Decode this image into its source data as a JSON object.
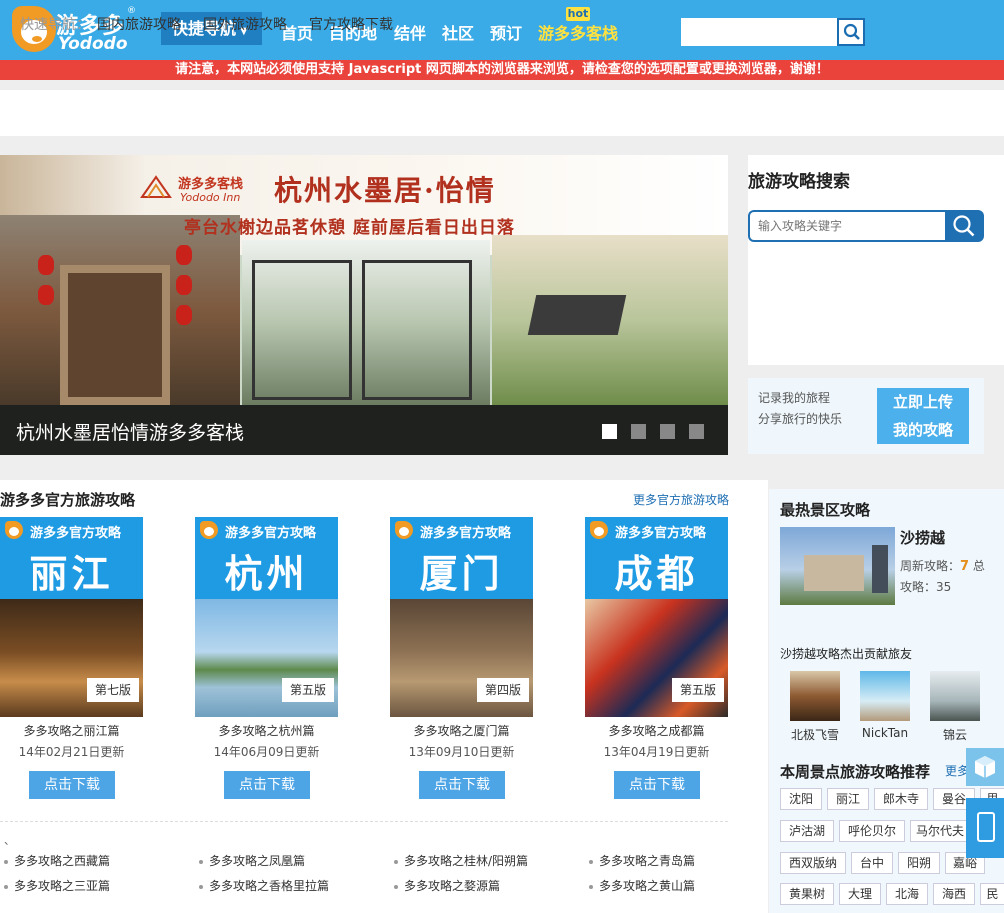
{
  "header": {
    "logo_cn": "游多多",
    "logo_en": "Yododo",
    "logo_reg": "®",
    "quicknav_label": "快捷导航",
    "nav": [
      "首页",
      "目的地",
      "结伴",
      "社区",
      "预订",
      "游多多客栈"
    ],
    "hot_tag": "hot",
    "search_value": ""
  },
  "warning": "请注意，本网站必须使用支持 Javascript 网页脚本的浏览器来浏览，请检查您的选项配置或更换浏览器，谢谢！",
  "quickbar": {
    "label": "快速导航：",
    "links": [
      "国内旅游攻略",
      "国外旅游攻略",
      "官方攻略下载"
    ]
  },
  "banner": {
    "brand_cn": "游多多客栈",
    "brand_en": "Yododo Inn",
    "title": "杭州水墨居·怡情",
    "subtitle": "亭台水榭边品茗休憩 庭前屋后看日出日落",
    "caption": "杭州水墨居怡情游多多客栈",
    "slides": 4,
    "active_slide": 1
  },
  "guide_search": {
    "title": "旅游攻略搜索",
    "placeholder": "输入攻略关键字"
  },
  "upload": {
    "line1": "记录我的旅程",
    "line2": "分享旅行的快乐",
    "button_line1": "立即上传",
    "button_line2": "我的攻略"
  },
  "official": {
    "title": "游多多官方旅游攻略",
    "more": "更多官方旅游攻略",
    "card_header": "游多多官方攻略",
    "download_label": "点击下载",
    "cards": [
      {
        "city": "丽江",
        "edition": "第七版",
        "label": "多多攻略之丽江篇",
        "date": "14年02月21日更新"
      },
      {
        "city": "杭州",
        "edition": "第五版",
        "label": "多多攻略之杭州篇",
        "date": "14年06月09日更新"
      },
      {
        "city": "厦门",
        "edition": "第四版",
        "label": "多多攻略之厦门篇",
        "date": "13年09月10日更新"
      },
      {
        "city": "成都",
        "edition": "第五版",
        "label": "多多攻略之成都篇",
        "date": "13年04月19日更新"
      }
    ],
    "tick": "、",
    "list": [
      [
        "多多攻略之西藏篇",
        "多多攻略之凤凰篇",
        "多多攻略之桂林/阳朔篇",
        "多多攻略之青岛篇"
      ],
      [
        "多多攻略之三亚篇",
        "多多攻略之香格里拉篇",
        "多多攻略之婺源篇",
        "多多攻略之黄山篇"
      ]
    ]
  },
  "hot": {
    "title": "最热景区攻略",
    "name": "沙捞越",
    "weekly_label": "周新攻略：",
    "weekly_value": "7",
    "total_suffix": "总",
    "total_label": "攻略：",
    "total_value": "35",
    "contrib_title": "沙捞越攻略杰出贡献旅友",
    "contributors": [
      "北极飞雪",
      "NickTan",
      "锦云"
    ]
  },
  "week": {
    "title": "本周景点旅游攻略推荐",
    "more": "更多",
    "rows": [
      [
        "沈阳",
        "丽江",
        "郎木寺",
        "曼谷",
        "里"
      ],
      [
        "泸沽湖",
        "呼伦贝尔",
        "马尔代夫"
      ],
      [
        "西双版纳",
        "台中",
        "阳朔",
        "嘉峪"
      ],
      [
        "黄果树",
        "大理",
        "北海",
        "海西",
        "民"
      ]
    ]
  },
  "colors": {
    "header": "#3aabe6",
    "warning": "#e9433c",
    "accent": "#1f6fb3",
    "hot": "#ffe23f"
  }
}
